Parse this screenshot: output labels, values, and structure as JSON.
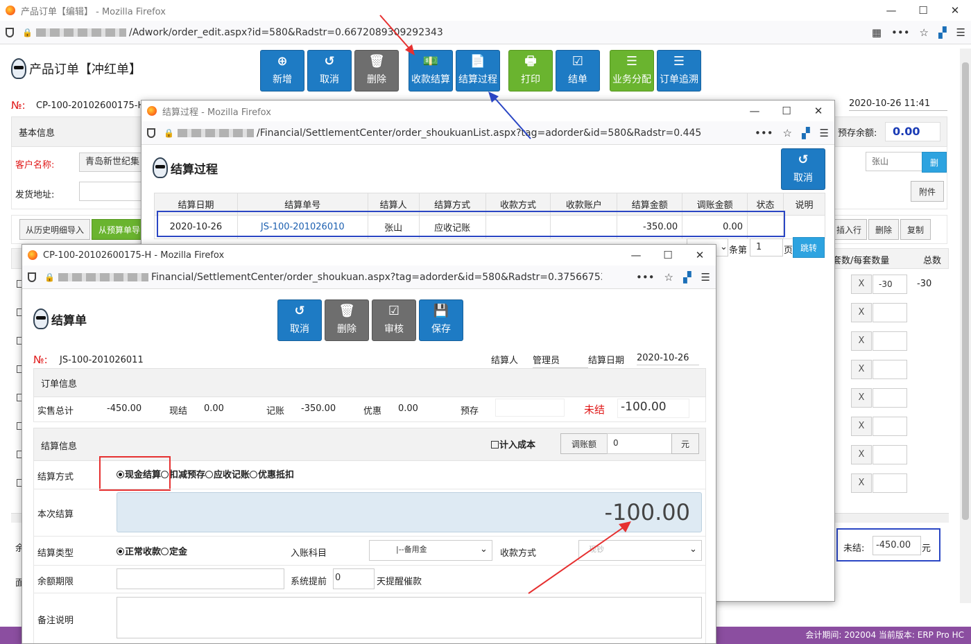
{
  "main_window": {
    "title": "产品订单【编辑】 - Mozilla Firefox",
    "url": "/Adwork/order_edit.aspx?id=580&Radstr=0.6672089309292343",
    "page_title": "产品订单【冲红单】",
    "toolbar": [
      "新增",
      "取消",
      "删除",
      "收款结算",
      "结算过程",
      "打印",
      "结单",
      "业务分配",
      "订单追溯"
    ],
    "order_no_label": "№:",
    "order_no": "CP-100-20102600175-H",
    "datetime": "2020-10-26 11:41",
    "section_basic": "基本信息",
    "prestore_label": "预存余额:",
    "prestore_value": "0.00",
    "customer_label": "客户名称:",
    "customer_value": "青岛新世纪集",
    "address_label": "发货地址:",
    "salesperson": "张山",
    "del_short": "删",
    "attach": "附件",
    "tab_history": "从历史明细导入",
    "tab_prebudget": "从预算单导",
    "insert_row": "插入行",
    "delete": "删除",
    "copy": "复制",
    "col_qty": "套数/每套数量",
    "col_total": "总数",
    "first_row_qty": "-30",
    "first_row_total": "-30",
    "x_label": "X",
    "unsettled_label": "未结:",
    "unsettled_value": "-450.00",
    "currency": "元",
    "left_partial_a": "余",
    "left_partial_b": "面",
    "status": "会计期间: 202004 当前版本: ERP Pro HC"
  },
  "settle_list": {
    "title": "结算过程 - Mozilla Firefox",
    "url": "/Financial/SettlementCenter/order_shoukuanList.aspx?tag=adorder&id=580&Radstr=0.44503073",
    "page_title": "结算过程",
    "cancel": "取消",
    "columns": [
      "结算日期",
      "结算单号",
      "结算人",
      "结算方式",
      "收款方式",
      "收款账户",
      "结算金额",
      "调账金额",
      "状态",
      "说明"
    ],
    "rows": [
      [
        "2020-10-26",
        "JS-100-201026010",
        "张山",
        "应收记账",
        "",
        "",
        "-350.00",
        "0.00",
        "",
        ""
      ]
    ],
    "pager_rows_label": "条第",
    "pager_page": "1",
    "pager_page_label": "页",
    "jump": "跳转"
  },
  "settle_form": {
    "title": "CP-100-20102600175-H - Mozilla Firefox",
    "url": "Financial/SettlementCenter/order_shoukuan.aspx?tag=adorder&id=580&Radstr=0.37566753290",
    "page_title": "结算单",
    "toolbar": [
      "取消",
      "删除",
      "审核",
      "保存"
    ],
    "no_label": "№:",
    "no_value": "JS-100-201026011",
    "settler_label": "结算人",
    "settler_value": "管理员",
    "date_label": "结算日期",
    "date_value": "2020-10-26",
    "order_info": "订单信息",
    "actual_total_label": "实售总计",
    "actual_total": "-450.00",
    "cash_label": "现结",
    "cash": "0.00",
    "account_label": "记账",
    "account": "-350.00",
    "discount_label": "优惠",
    "discount": "0.00",
    "prestore_label": "预存",
    "unsettled_label": "未结",
    "unsettled": "-100.00",
    "settle_info": "结算信息",
    "cost_label": "计入成本",
    "adjust_label": "调账额",
    "adjust_value": "0",
    "yuan": "元",
    "method_label": "结算方式",
    "methods": [
      "现金结算",
      "扣减预存",
      "应收记账",
      "优惠抵扣"
    ],
    "this_settle_label": "本次结算",
    "this_settle": "-100.00",
    "type_label": "结算类型",
    "types": [
      "正常收款",
      "定金"
    ],
    "subject_label": "入账科目",
    "subject_value": "|--备用金",
    "receive_label": "收款方式",
    "receive_value": "现钞",
    "balance_label": "余额期限",
    "remind_label": "系统提前",
    "remind_value": "0",
    "remind_suffix": "天提醒催款",
    "note_label": "备注说明"
  }
}
